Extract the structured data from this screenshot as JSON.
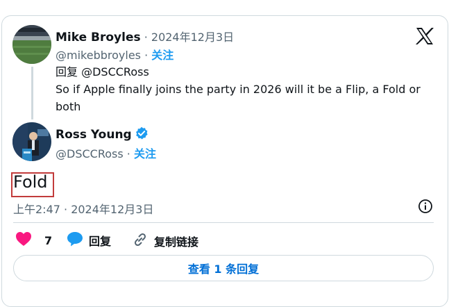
{
  "parent_tweet": {
    "author_name": "Mike Broyles",
    "date_sep": " · ",
    "date": "2024年12月3日",
    "handle": "@mikebbroyles",
    "handle_sep": " · ",
    "follow_label": "关注",
    "reply_prefix": "回复 ",
    "reply_to": "@DSCCRoss",
    "text": "So if Apple finally joins the party in 2026 will it be a Flip, a Fold or both"
  },
  "main_tweet": {
    "author_name": "Ross Young",
    "handle": "@DSCCRoss",
    "handle_sep": " · ",
    "follow_label": "关注",
    "text": "Fold",
    "timestamp": "上午2:47 · 2024年12月3日"
  },
  "actions": {
    "like_count": "7",
    "reply_label": "回复",
    "copy_link_label": "复制链接"
  },
  "view_replies_label": "查看 1 条回复",
  "colors": {
    "accent": "#1d9bf0",
    "like": "#f91880",
    "border": "#cfd9de",
    "muted": "#536471",
    "highlight_box": "#c23b3b"
  },
  "icons": [
    "x-logo-icon",
    "verified-badge-icon",
    "info-icon",
    "heart-icon",
    "reply-bubble-icon",
    "link-icon"
  ]
}
